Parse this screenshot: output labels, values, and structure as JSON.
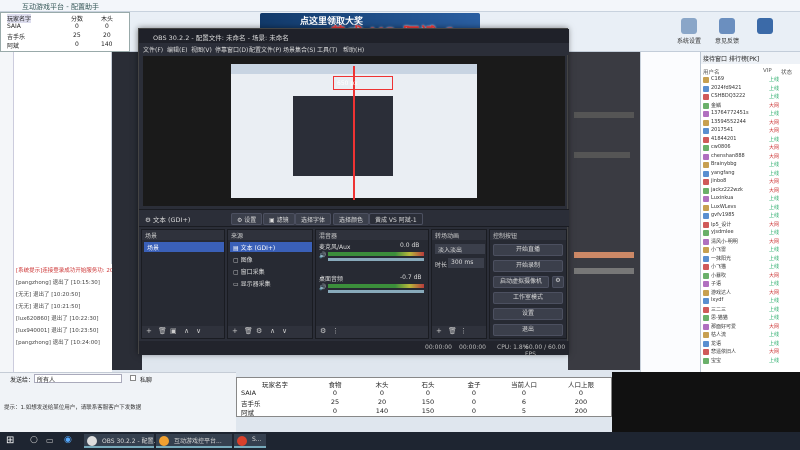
{
  "background_app": {
    "title": "互动游戏平台 - 配置助手",
    "toolbar": {
      "items": [
        {
          "label": "系统设置"
        },
        {
          "label": "意见反馈"
        }
      ]
    },
    "right_tabs": [
      "接待窗口",
      "排行榜[PK]"
    ],
    "user_list_header": [
      "用户名",
      "VIP",
      "状态"
    ],
    "users": [
      {
        "name": "C169",
        "status": "上线"
      },
      {
        "name": "2024fd9421",
        "status": "上线"
      },
      {
        "name": "CSHBDQ3222",
        "status": "上线"
      },
      {
        "name": "金鳞",
        "status": "大网"
      },
      {
        "name": "13764772451s",
        "status": "上线"
      },
      {
        "name": "13594552244",
        "status": "大网"
      },
      {
        "name": "2017541",
        "status": "大网"
      },
      {
        "name": "41844201",
        "status": "上线"
      },
      {
        "name": "cw0806",
        "status": "大网"
      },
      {
        "name": "chenshan888",
        "status": "大网"
      },
      {
        "name": "Brainybbg",
        "status": "上线"
      },
      {
        "name": "yangfang",
        "status": "上线"
      },
      {
        "name": "jinbo8",
        "status": "大网"
      },
      {
        "name": "jackz222wzk",
        "status": "大网"
      },
      {
        "name": "Luxinkua",
        "status": "上线"
      },
      {
        "name": "LuxWLevs",
        "status": "上线"
      },
      {
        "name": "gvfv1985",
        "status": "上线"
      },
      {
        "name": "lp5_设计",
        "status": "大网"
      },
      {
        "name": "yjsdmlee",
        "status": "上线"
      },
      {
        "name": "清风小-明明",
        "status": "大网"
      },
      {
        "name": "小飞雷",
        "status": "上线"
      },
      {
        "name": "一抹阳光",
        "status": "上线"
      },
      {
        "name": "小飞猫",
        "status": "上线"
      },
      {
        "name": "小暴吹",
        "status": "大网"
      },
      {
        "name": "子语",
        "status": "上线"
      },
      {
        "name": "游戏达人",
        "status": "大网"
      },
      {
        "name": "lxydf",
        "status": "上线"
      },
      {
        "name": "三二三",
        "status": "上线"
      },
      {
        "name": "思-猫猫",
        "status": "上线"
      },
      {
        "name": "那面好可爱",
        "status": "大网"
      },
      {
        "name": "枯人流",
        "status": "上线"
      },
      {
        "name": "龙语",
        "status": "上线"
      },
      {
        "name": "悲遥依旧人",
        "status": "大网"
      },
      {
        "name": "宝宝",
        "status": "上线"
      }
    ],
    "left_log": [
      "[系统提示]连接登录成功开始服务功: 20",
      "[pangzhong] 退出了 [10:15:30]",
      "[无无] 退出了 [10:20:50]",
      "[无无] 退出了 [10:21:50]",
      "[lux620860] 退出了 [10:22:30]",
      "[lux940001] 退出了 [10:23:50]",
      "[pangzhong] 退出了 [10:24:00]"
    ],
    "bottom_input_label": "发送给：",
    "bottom_input_value": "所有人",
    "bottom_checkbox": "私聊",
    "bottom_hint": "提示：1.如想发送给某位用户，请联系客服客户下发数据"
  },
  "mini_table": {
    "headers": [
      "玩家名字",
      "分数",
      "木头"
    ],
    "rows": [
      [
        "SAIA",
        "0",
        "0"
      ],
      [
        "吉手乐",
        "25",
        "20"
      ],
      [
        "阿斌",
        "0",
        "140"
      ]
    ]
  },
  "promo": {
    "banner": "点这里领取大奖",
    "vs": "黄成 VS 阿斌-1"
  },
  "obs": {
    "title": "OBS 30.2.2 - 配置文件: 未命名 - 场景: 未命名",
    "menu": [
      "文件(F)",
      "编辑(E)",
      "视图(V)",
      "停靠窗口(D)",
      "配置文件(P)",
      "场景集合(S)",
      "工具(T)",
      "帮助(H)"
    ],
    "source_label": "文本 (GDI+)",
    "buttons": [
      "设置",
      "滤镜",
      "选择字体",
      "选择颜色",
      "黄成 VS 阿斌-1"
    ],
    "docks": {
      "scenes": {
        "title": "场景",
        "items": [
          "场景"
        ]
      },
      "sources": {
        "title": "来源",
        "items": [
          "文本 (GDI+)",
          "图像",
          "窗口采集",
          "显示器采集"
        ]
      },
      "mixer": {
        "title": "混音器",
        "channels": [
          {
            "name": "麦克风/Aux",
            "db": "0.0 dB"
          },
          {
            "name": "桌面音频",
            "db": "-0.7 dB"
          }
        ]
      },
      "transitions": {
        "title": "转场动画",
        "mode": "淡入淡出",
        "duration_label": "时长",
        "duration": "300 ms"
      },
      "controls": {
        "title": "控制按钮",
        "items": [
          "开始直播",
          "开始录制",
          "启动虚拟摄像机",
          "工作室模式",
          "设置",
          "退出"
        ]
      }
    },
    "status": {
      "time1": "00:00:00",
      "time2": "00:00:00",
      "cpu": "CPU: 1.8%",
      "fps": "60.00 / 60.00 FPS"
    },
    "preview_label": "650 px"
  },
  "game_table": {
    "headers": [
      "玩家名字",
      "食物",
      "木头",
      "石头",
      "金子",
      "当前人口",
      "人口上限"
    ],
    "rows": [
      [
        "SAIA",
        "0",
        "0",
        "0",
        "0",
        "0",
        "0"
      ],
      [
        "吉手乐",
        "25",
        "20",
        "150",
        "0",
        "6",
        "200"
      ],
      [
        "阿斌",
        "0",
        "140",
        "150",
        "0",
        "5",
        "200"
      ]
    ]
  },
  "taskbar": {
    "tasks": [
      {
        "label": "OBS 30.2.2 - 配置...",
        "color": "#e6e6e6"
      },
      {
        "label": "互动游戏控平台...",
        "color": "#f0a030"
      },
      {
        "label": "S...",
        "color": "#d9412b"
      }
    ]
  },
  "colors": {
    "accent": "#2a6ad6",
    "danger": "#ff3b3b",
    "obs_bg": "#2b2e38"
  }
}
